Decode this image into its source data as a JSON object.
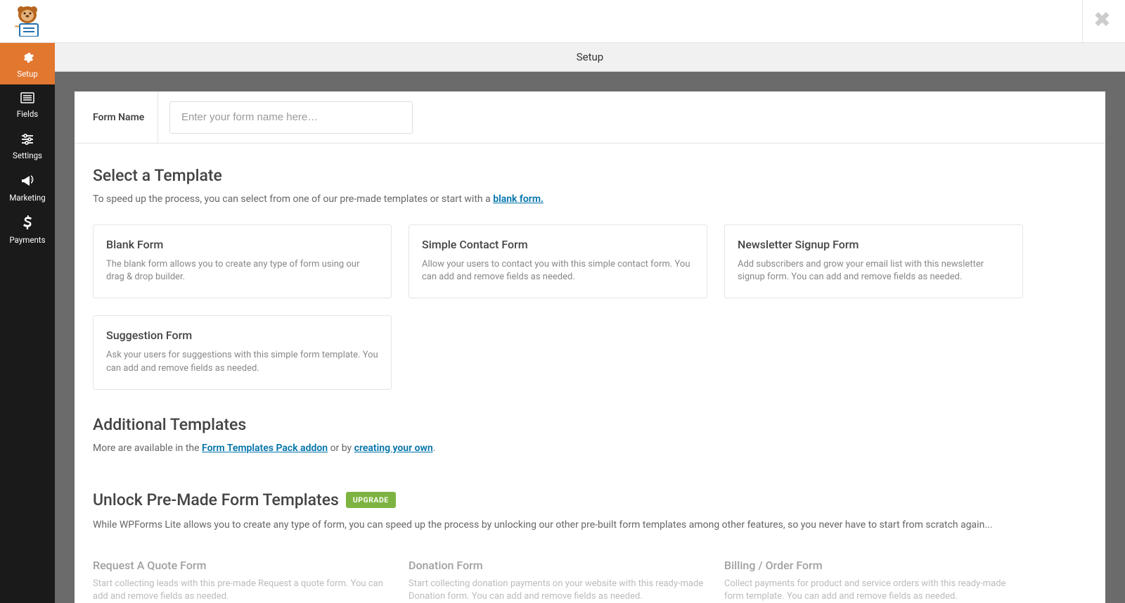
{
  "header": {
    "subheader_title": "Setup"
  },
  "sidebar": {
    "items": [
      {
        "label": "Setup",
        "icon": "gear"
      },
      {
        "label": "Fields",
        "icon": "list"
      },
      {
        "label": "Settings",
        "icon": "sliders"
      },
      {
        "label": "Marketing",
        "icon": "bullhorn"
      },
      {
        "label": "Payments",
        "icon": "dollar"
      }
    ]
  },
  "form_name": {
    "label": "Form Name",
    "placeholder": "Enter your form name here…",
    "value": ""
  },
  "select_template": {
    "title": "Select a Template",
    "desc_prefix": "To speed up the process, you can select from one of our pre-made templates or start with a ",
    "blank_link": "blank form."
  },
  "templates": [
    {
      "title": "Blank Form",
      "desc": "The blank form allows you to create any type of form using our drag & drop builder."
    },
    {
      "title": "Simple Contact Form",
      "desc": "Allow your users to contact you with this simple contact form. You can add and remove fields as needed."
    },
    {
      "title": "Newsletter Signup Form",
      "desc": "Add subscribers and grow your email list with this newsletter signup form. You can add and remove fields as needed."
    },
    {
      "title": "Suggestion Form",
      "desc": "Ask your users for suggestions with this simple form template. You can add and remove fields as needed."
    }
  ],
  "additional": {
    "title": "Additional Templates",
    "desc_prefix": "More are available in the ",
    "link1": "Form Templates Pack addon",
    "desc_mid": " or by ",
    "link2": "creating your own",
    "desc_suffix": "."
  },
  "unlock": {
    "title": "Unlock Pre-Made Form Templates",
    "badge": "UPGRADE",
    "desc": "While WPForms Lite allows you to create any type of form, you can speed up the process by unlocking our other pre-built form templates among other features, so you never have to start from scratch again..."
  },
  "locked_templates": [
    {
      "title": "Request A Quote Form",
      "desc": "Start collecting leads with this pre-made Request a quote form. You can add and remove fields as needed."
    },
    {
      "title": "Donation Form",
      "desc": "Start collecting donation payments on your website with this ready-made Donation form. You can add and remove fields as needed."
    },
    {
      "title": "Billing / Order Form",
      "desc": "Collect payments for product and service orders with this ready-made form template. You can add and remove fields as needed."
    }
  ]
}
